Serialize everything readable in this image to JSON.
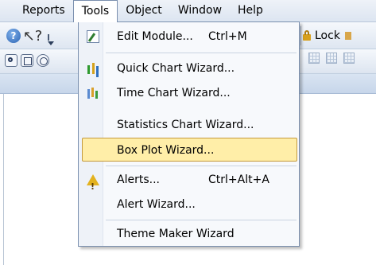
{
  "menubar": {
    "items": [
      "Reports",
      "Tools",
      "Object",
      "Window",
      "Help"
    ]
  },
  "toolbar": {
    "lock_label": "Lock"
  },
  "tools_menu": {
    "items": [
      {
        "label": "Edit Module...",
        "shortcut": "Ctrl+M",
        "icon": "edit-module-icon"
      },
      {
        "label": "Quick Chart Wizard...",
        "shortcut": "",
        "icon": "quick-chart-icon"
      },
      {
        "label": "Time Chart Wizard...",
        "shortcut": "",
        "icon": "time-chart-icon"
      },
      {
        "label": "Statistics Chart Wizard...",
        "shortcut": "",
        "icon": ""
      },
      {
        "label": "Box Plot Wizard...",
        "shortcut": "",
        "icon": "",
        "highlighted": true
      },
      {
        "label": "Alerts...",
        "shortcut": "Ctrl+Alt+A",
        "icon": "alert-icon"
      },
      {
        "label": "Alert Wizard...",
        "shortcut": "",
        "icon": ""
      },
      {
        "label": "Theme Maker Wizard",
        "shortcut": "",
        "icon": ""
      }
    ]
  },
  "colors": {
    "highlight": "#ffeea8",
    "highlight_border": "#c49a3c"
  }
}
